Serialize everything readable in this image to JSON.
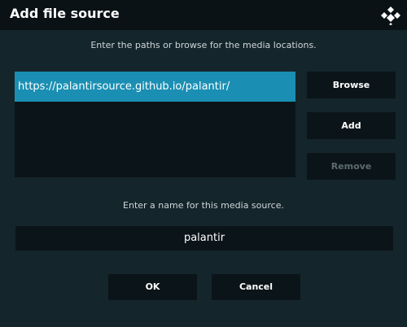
{
  "dialog": {
    "title": "Add file source",
    "logo_icon": "kodi-logo-icon",
    "accent_color": "#1a8fb3",
    "instructions": "Enter the paths or browse for the media locations.",
    "paths": [
      "https://palantirsource.github.io/palantir/"
    ],
    "buttons": {
      "browse": "Browse",
      "add": "Add",
      "remove": "Remove"
    },
    "name_label": "Enter a name for this media source.",
    "name_value": "palantir",
    "ok": "OK",
    "cancel": "Cancel"
  }
}
